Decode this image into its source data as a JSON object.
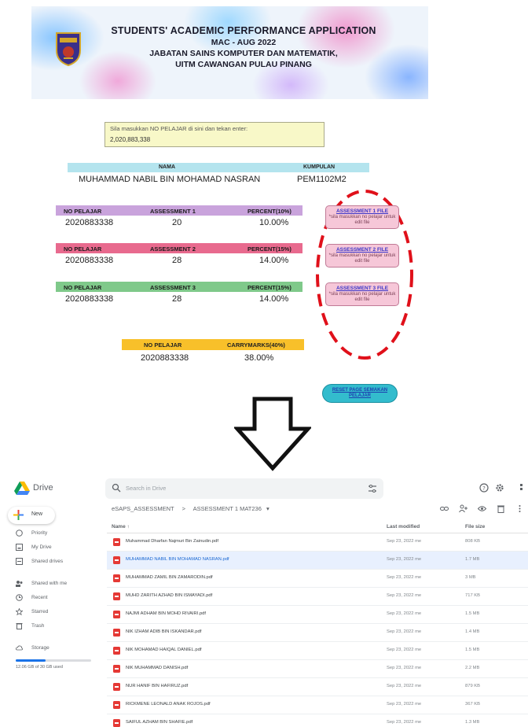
{
  "banner": {
    "title": "STUDENTS' ACADEMIC PERFORMANCE APPLICATION",
    "session": "MAC - AUG 2022",
    "department": "JABATAN SAINS KOMPUTER DAN MATEMATIK,",
    "campus": "UITM CAWANGAN PULAU PINANG"
  },
  "input": {
    "prompt": "Sila masukkan NO PELAJAR di sini dan tekan enter:",
    "value": "2,020,883,338"
  },
  "student": {
    "name_header": "NAMA",
    "group_header": "KUMPULAN",
    "name": "MUHAMMAD NABIL BIN MOHAMAD NASRAN",
    "group": "PEM1102M2"
  },
  "assessments": [
    {
      "id_header": "NO PELAJAR",
      "name": "ASSESSMENT 1",
      "percent_header": "PERCENT(10%)",
      "student_id": "2020883338",
      "score": "20",
      "percent": "10.00%",
      "color": "#c9a3dc",
      "file_button": "ASSESSMENT 1 FILE"
    },
    {
      "id_header": "NO PELAJAR",
      "name": "ASSESSMENT 2",
      "percent_header": "PERCENT(15%)",
      "student_id": "2020883338",
      "score": "28",
      "percent": "14.00%",
      "color": "#e86a8e",
      "file_button": "ASSESSMENT 2 FILE"
    },
    {
      "id_header": "NO PELAJAR",
      "name": "ASSESSMENT 3",
      "percent_header": "PERCENT(15%)",
      "student_id": "2020883338",
      "score": "28",
      "percent": "14.00%",
      "color": "#7fc98a",
      "file_button": "ASSESSMENT 3 FILE"
    }
  ],
  "file_hint": "*sila masukkan no pelajar untuk edit file",
  "carry": {
    "id_header": "NO PELAJAR",
    "marks_header": "CARRYMARKS(40%)",
    "student_id": "2020883338",
    "marks": "38.00%"
  },
  "reset_button": "RESET PAGE SEMAKAN PELAJAR",
  "drive": {
    "app_name": "Drive",
    "search_placeholder": "Search in Drive",
    "new_label": "New",
    "nav": [
      {
        "label": "Priority",
        "icon": "priority-icon"
      },
      {
        "label": "My Drive",
        "icon": "my-drive-icon"
      },
      {
        "label": "Shared drives",
        "icon": "shared-drives-icon"
      },
      {
        "label": "Shared with me",
        "icon": "shared-with-me-icon"
      },
      {
        "label": "Recent",
        "icon": "recent-icon"
      },
      {
        "label": "Starred",
        "icon": "starred-icon"
      },
      {
        "label": "Trash",
        "icon": "trash-icon"
      },
      {
        "label": "Storage",
        "icon": "cloud-icon"
      }
    ],
    "storage_text": "12.06 GB of 30 GB used",
    "storage_fraction": 0.4,
    "breadcrumb": {
      "root": "eSAPS_ASSESSMENT",
      "separator": ">",
      "current": "ASSESSMENT 1 MAT236"
    },
    "columns": {
      "name": "Name",
      "modified": "Last modified",
      "size": "File size"
    },
    "files": [
      {
        "name": "Muhammad Dharfan Najmuri Bin Zainudin.pdf",
        "modified": "Sep 23, 2022 me",
        "size": "808 KB",
        "selected": false
      },
      {
        "name": "MUHAMMAD NABIL BIN MOHAMAD NASRAN.pdf",
        "modified": "Sep 23, 2022 me",
        "size": "1.7 MB",
        "selected": true
      },
      {
        "name": "MUHAMMAD ZAMIL BIN ZAMARODIN.pdf",
        "modified": "Sep 23, 2022 me",
        "size": "3 MB",
        "selected": false
      },
      {
        "name": "MUHD ZARITH AZHAD BIN ISMAYADI.pdf",
        "modified": "Sep 23, 2022 me",
        "size": "717 KB",
        "selected": false
      },
      {
        "name": "NAJMI ADHAM BIN MOHD RIVAIRI.pdf",
        "modified": "Sep 23, 2022 me",
        "size": "1.5 MB",
        "selected": false
      },
      {
        "name": "NIK IZHAM ADIB BIN ISKANDAR.pdf",
        "modified": "Sep 23, 2022 me",
        "size": "1.4 MB",
        "selected": false
      },
      {
        "name": "NIK MOHAMAD HAIQAL DANIEL.pdf",
        "modified": "Sep 23, 2022 me",
        "size": "1.5 MB",
        "selected": false
      },
      {
        "name": "NIK MUHAMMAD DANISH.pdf",
        "modified": "Sep 23, 2022 me",
        "size": "2.2 MB",
        "selected": false
      },
      {
        "name": "NUR HANIF BIN HAFIRUZ.pdf",
        "modified": "Sep 23, 2022 me",
        "size": "879 KB",
        "selected": false
      },
      {
        "name": "RICKMENE LEONALD ANAK ROJOS.pdf",
        "modified": "Sep 23, 2022 me",
        "size": "367 KB",
        "selected": false
      },
      {
        "name": "SAIFUL AZHAM BIN SHAFIE.pdf",
        "modified": "Sep 23, 2022 me",
        "size": "1.3 MB",
        "selected": false
      }
    ]
  }
}
